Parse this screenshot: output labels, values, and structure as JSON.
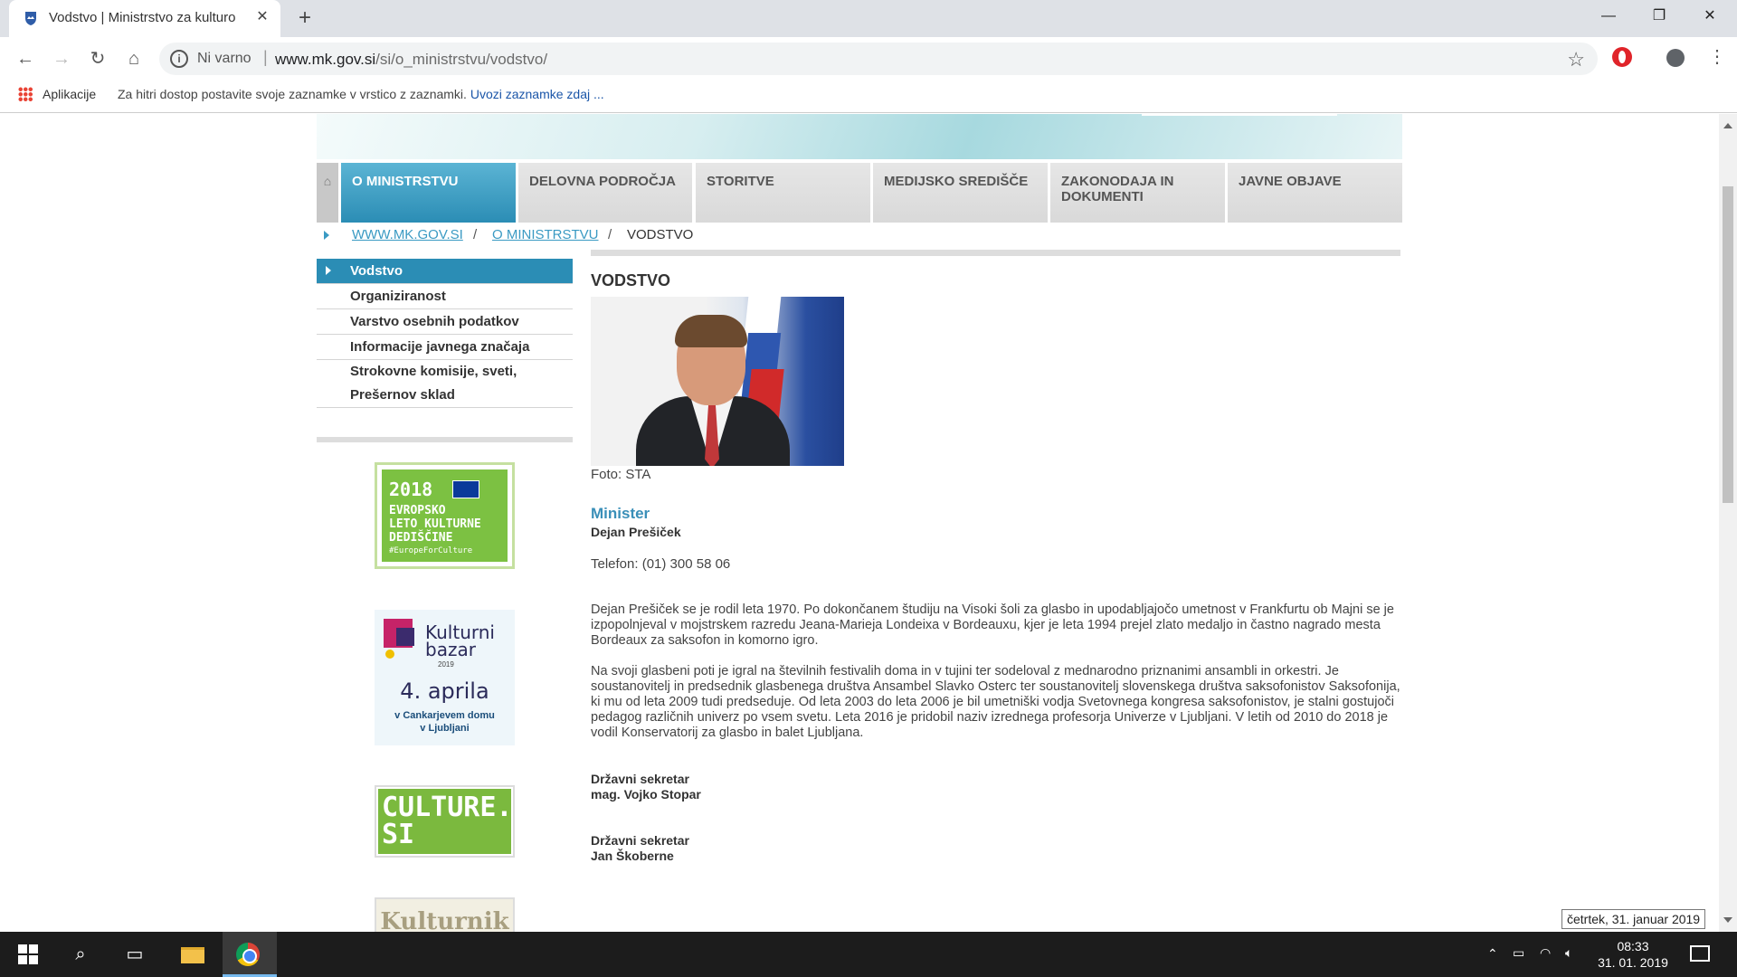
{
  "browser": {
    "tab_title": "Vodstvo | Ministrstvo za kulturo",
    "security_label": "Ni varno",
    "url_host": "www.mk.gov.si",
    "url_path": "/si/o_ministrstvu/vodstvo/",
    "bookmarks_apps": "Aplikacije",
    "bookmarks_hint": "Za hitri dostop postavite svoje zaznamke v vrstico z zaznamki.",
    "bookmarks_import": "Uvozi zaznamke zdaj ..."
  },
  "nav": {
    "items": [
      "O MINISTRSTVU",
      "DELOVNA PODROČJA",
      "STORITVE",
      "MEDIJSKO SREDIŠČE",
      "ZAKONODAJA IN DOKUMENTI",
      "JAVNE OBJAVE"
    ],
    "active_index": 0
  },
  "breadcrumb": {
    "home": "WWW.MK.GOV.SI",
    "section": "O MINISTRSTVU",
    "current": "VODSTVO",
    "separator": "/"
  },
  "sidebar": {
    "items": [
      "Vodstvo",
      "Organiziranost",
      "Varstvo osebnih podatkov",
      "Informacije javnega značaja",
      "Strokovne komisije, sveti,",
      "Prešernov sklad"
    ]
  },
  "promos": {
    "year_2018": {
      "year": "2018",
      "text_line1": "EVROPSKO",
      "text_line2": "LETO KULTURNE",
      "text_line3": "DEDIŠČINE",
      "tag": "#EuropeForCulture"
    },
    "bazar": {
      "title_line1": "Kulturni",
      "title_line2": "bazar",
      "year": "2019",
      "date": "4. aprila",
      "place_line1": "v Cankarjevem domu",
      "place_line2": "v Ljubljani"
    },
    "culture": {
      "line1": "CULTURE.",
      "line2": "SI"
    },
    "kulturnik": "Kulturnik"
  },
  "content": {
    "title": "VODSTVO",
    "photo_caption": "Foto: STA",
    "minister_role": "Minister",
    "minister_name": "Dejan Prešiček",
    "phone": "Telefon: (01) 300 58 06",
    "bio_p1": "Dejan Prešiček se je rodil leta 1970. Po dokončanem študiju na Visoki šoli za glasbo in upodabljajočo umetnost v Frankfurtu ob Majni se je izpopolnjeval v mojstrskem razredu Jeana-Marieja Londeixa v Bordeauxu, kjer je leta 1994 prejel zlato medaljo in častno nagrado mesta Bordeaux za saksofon in komorno igro.",
    "bio_p2": "Na svoji glasbeni poti je igral na številnih festivalih doma in v tujini ter sodeloval z mednarodno priznanimi ansambli in orkestri. Je soustanovitelj in predsednik glasbenega društva Ansambel Slavko Osterc ter soustanovitelj slovenskega društva saksofonistov Saksofonija, ki mu od leta 2009 tudi predseduje. Od leta 2003 do leta 2006 je bil umetniški vodja Svetovnega kongresa saksofonistov, je stalni gostujoči pedagog različnih univerz po vsem svetu. Leta 2016 je pridobil naziv izrednega profesorja Univerze v Ljubljani. V letih od 2010 do 2018 je vodil Konservatorij za glasbo in balet Ljubljana.",
    "secretary1_role": "Državni sekretar",
    "secretary1_name": "mag. Vojko Stopar",
    "secretary2_role": "Državni sekretar",
    "secretary2_name": "Jan Škoberne"
  },
  "taskbar": {
    "time": "08:33",
    "date": "31. 01. 2019",
    "tooltip": "četrtek, 31. januar 2019"
  },
  "icons": {
    "tab_favicon": "coat-of-arms-icon",
    "home": "home-icon"
  }
}
